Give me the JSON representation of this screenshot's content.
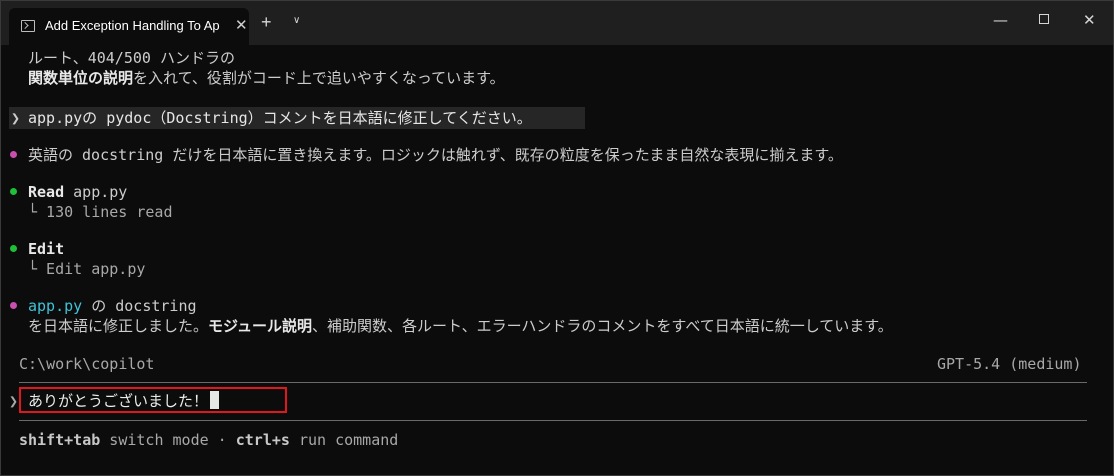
{
  "window": {
    "tab_title": "Add Exception Handling To Ap",
    "tab_close": "✕",
    "new_tab": "+",
    "dropdown": "∨",
    "minimize": "—",
    "close": "✕"
  },
  "transcript": {
    "prev_line1": "ルート、404/500 ハンドラの",
    "prev_line2_bold": "関数単位の説明",
    "prev_line2_rest": "を入れて、役割がコード上で追いやすくなっています。",
    "user_prompt_marker": "❯",
    "user_prompt": "app.pyの pydoc（Docstring）コメントを日本語に修正してください。",
    "assistant_plan": "英語の docstring だけを日本語に置き換えます。ロジックは触れず、既存の粒度を保ったまま自然な表現に揃えます。",
    "read_label": "Read",
    "read_target": "app.py",
    "read_result": "└ 130 lines read",
    "edit_label": "Edit",
    "edit_result": "└ Edit app.py",
    "summary_file": "app.py",
    "summary_line1_rest": " の docstring",
    "summary_line2_a": "を日本語に修正しました。",
    "summary_line2_bold": "モジュール説明",
    "summary_line2_b": "、補助関数、各ルート、エラーハンドラのコメントをすべて日本語に統一しています。"
  },
  "status": {
    "cwd": "C:\\work\\copilot",
    "model": "GPT-5.4 (medium)"
  },
  "input": {
    "marker": "❯",
    "value": "ありがとうございました！"
  },
  "footer": {
    "key1": "shift+tab",
    "action1": " switch mode · ",
    "key2": "ctrl+s",
    "action2": " run command"
  },
  "colors": {
    "background": "#0c0c0c",
    "pink_bullet": "#c84fb0",
    "green_bullet": "#1fbf3a",
    "highlight_box": "#e0181d",
    "accent_cyan": "#3fc3d6"
  }
}
